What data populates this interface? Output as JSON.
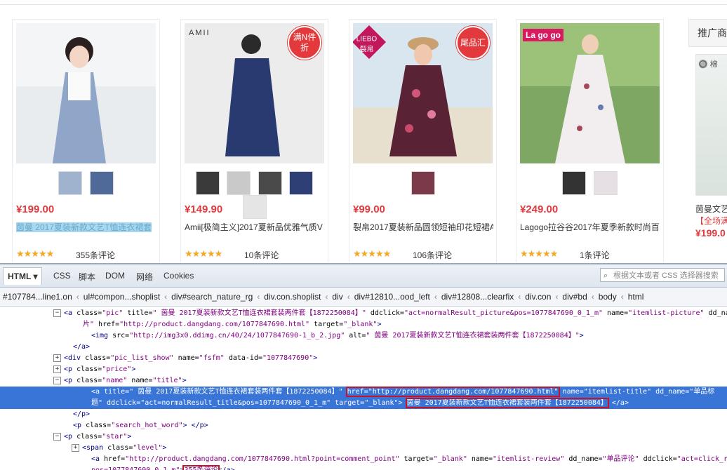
{
  "products": [
    {
      "price": "¥199.00",
      "title": "茵曼 2017夏装新款文艺T恤连衣裙套",
      "reviews": "355条评论",
      "stars": "★★★★★",
      "badge": "",
      "brand": "",
      "thumbs": 2
    },
    {
      "price": "¥149.90",
      "title": "Amii[极简主义]2017夏新品优雅气质V",
      "reviews": "10条评论",
      "stars": "★★★★★",
      "badge": "满N件 折",
      "brand": "AMII",
      "thumbs": 5
    },
    {
      "price": "¥99.00",
      "title": "裂帛2017夏装新品圆领短袖印花短裙A",
      "reviews": "106条评论",
      "stars": "★★★★★",
      "badge": "尾品汇",
      "brand": "LIEBO 裂帛",
      "thumbs": 1
    },
    {
      "price": "¥249.00",
      "title": "Lagogo拉谷谷2017年夏季新款时尚百",
      "reviews": "1条评论",
      "stars": "★★★★★",
      "badge": "",
      "brand": "La go go",
      "thumbs": 2
    }
  ],
  "ad": {
    "title": "推广商",
    "logo": "棉",
    "line1": "茵曼文艺",
    "line2": "【全场满",
    "price": "¥199.0"
  },
  "devtools": {
    "tabs": [
      "HTML ▾",
      "CSS",
      "脚本",
      "DOM",
      "网络",
      "Cookies"
    ],
    "search_placeholder": "根据文本或者 CSS 选择器搜索",
    "breadcrumbs": [
      "#107784...line1.on",
      "ul#compon...shoplist",
      "div#search_nature_rg",
      "div.con.shoplist",
      "div",
      "div#12810...ood_left",
      "div#12808...clearfix",
      "div.con",
      "div#bd",
      "body",
      "html"
    ],
    "lines": [
      {
        "indent": 90,
        "toggle": "−",
        "parts": [
          [
            "tag",
            "<a "
          ],
          [
            "attr",
            "class="
          ],
          [
            "val",
            "\"pic\""
          ],
          [
            "attr",
            " title="
          ],
          [
            "val",
            "\" 茵曼 2017夏装新款文艺T恤连衣裙套装两件套【1872250084】\""
          ],
          [
            "attr",
            " ddclick="
          ],
          [
            "val",
            "\"act=normalResult_picture&pos=1077847690_0_1_m\""
          ],
          [
            "attr",
            " name="
          ],
          [
            "val",
            "\"itemlist-picture\""
          ],
          [
            "attr",
            " dd_na"
          ]
        ]
      },
      {
        "indent": 118,
        "toggle": "",
        "parts": [
          [
            "val",
            "片\""
          ],
          [
            "attr",
            " href="
          ],
          [
            "val",
            "\"http://product.dangdang.com/1077847690.html\""
          ],
          [
            "attr",
            " target="
          ],
          [
            "val",
            "\"_blank\""
          ],
          [
            "tag",
            ">"
          ]
        ]
      },
      {
        "indent": 130,
        "toggle": "",
        "parts": [
          [
            "tag",
            "<img "
          ],
          [
            "attr",
            "src="
          ],
          [
            "val",
            "\"http://img3x0.ddimg.cn/40/24/1077847690-1_b_2.jpg\""
          ],
          [
            "attr",
            " alt="
          ],
          [
            "val",
            "\" 茵曼 2017夏装新款文艺T恤连衣裙套装两件套【1872250084】\""
          ],
          [
            "tag",
            ">"
          ]
        ]
      },
      {
        "indent": 104,
        "toggle": "",
        "parts": [
          [
            "tag",
            "</a>"
          ]
        ]
      },
      {
        "indent": 90,
        "toggle": "+",
        "parts": [
          [
            "tag",
            "<div "
          ],
          [
            "attr",
            "class="
          ],
          [
            "val",
            "\"pic_list_show\""
          ],
          [
            "attr",
            " name="
          ],
          [
            "val",
            "\"fsfm\""
          ],
          [
            "attr",
            " data-id="
          ],
          [
            "val",
            "\"1077847690\""
          ],
          [
            "tag",
            ">"
          ]
        ]
      },
      {
        "indent": 90,
        "toggle": "+",
        "parts": [
          [
            "tag",
            "<p "
          ],
          [
            "attr",
            "class="
          ],
          [
            "val",
            "\"price\""
          ],
          [
            "tag",
            ">"
          ]
        ]
      },
      {
        "indent": 90,
        "toggle": "−",
        "parts": [
          [
            "tag",
            "<p "
          ],
          [
            "attr",
            "class="
          ],
          [
            "val",
            "\"name\""
          ],
          [
            "attr",
            " name="
          ],
          [
            "val",
            "\"title\""
          ],
          [
            "tag",
            ">"
          ]
        ]
      },
      {
        "indent": 130,
        "toggle": "",
        "hl": true,
        "parts": [
          [
            "tag",
            "<a "
          ],
          [
            "attr",
            "title="
          ],
          [
            "val",
            "\" 茵曼 2017夏装新款文艺T恤连衣裙套装两件套【1872250084】\" "
          ],
          [
            "box",
            "href=\"http://product.dangdang.com/1077847690.html\""
          ],
          [
            "attr",
            " name="
          ],
          [
            "val",
            "\"itemlist-title\""
          ],
          [
            "attr",
            " dd_name="
          ],
          [
            "val",
            "\"单品标"
          ]
        ]
      },
      {
        "indent": 130,
        "toggle": "",
        "hl": true,
        "parts": [
          [
            "val",
            "题\""
          ],
          [
            "attr",
            " ddclick="
          ],
          [
            "val",
            "\"act=normalResult_title&pos=1077847690_0_1_m\""
          ],
          [
            "attr",
            " target="
          ],
          [
            "val",
            "\"_blank\""
          ],
          [
            "tag",
            "> "
          ],
          [
            "box",
            " 茵曼 2017夏装新款文艺T恤连衣裙套装两件套【1872250084】"
          ],
          [
            "tag",
            " </a>"
          ]
        ]
      },
      {
        "indent": 104,
        "toggle": "",
        "parts": [
          [
            "tag",
            "</p>"
          ]
        ]
      },
      {
        "indent": 104,
        "toggle": "",
        "parts": [
          [
            "tag",
            "<p "
          ],
          [
            "attr",
            "class="
          ],
          [
            "val",
            "\"search_hot_word\""
          ],
          [
            "tag",
            "> </p>"
          ]
        ]
      },
      {
        "indent": 90,
        "toggle": "−",
        "parts": [
          [
            "tag",
            "<p "
          ],
          [
            "attr",
            "class="
          ],
          [
            "val",
            "\"star\""
          ],
          [
            "tag",
            ">"
          ]
        ]
      },
      {
        "indent": 116,
        "toggle": "+",
        "parts": [
          [
            "tag",
            "<span "
          ],
          [
            "attr",
            "class="
          ],
          [
            "val",
            "\"level\""
          ],
          [
            "tag",
            ">"
          ]
        ]
      },
      {
        "indent": 130,
        "toggle": "",
        "parts": [
          [
            "tag",
            "<a "
          ],
          [
            "attr",
            "href="
          ],
          [
            "val",
            "\"http://product.dangdang.com/1077847690.html?point=comment_point\""
          ],
          [
            "attr",
            " target="
          ],
          [
            "val",
            "\"_blank\""
          ],
          [
            "attr",
            " name="
          ],
          [
            "val",
            "\"itemlist-review\""
          ],
          [
            "attr",
            " dd_name="
          ],
          [
            "val",
            "\"单品评论\""
          ],
          [
            "attr",
            " ddclick="
          ],
          [
            "val",
            "\"act=click_review_co"
          ]
        ]
      },
      {
        "indent": 130,
        "toggle": "",
        "parts": [
          [
            "val",
            "pos=1077847690_0_1_m\""
          ],
          [
            "tag",
            ">"
          ],
          [
            "box",
            "355条评论"
          ],
          [
            "tag",
            "</a>"
          ]
        ]
      }
    ]
  }
}
